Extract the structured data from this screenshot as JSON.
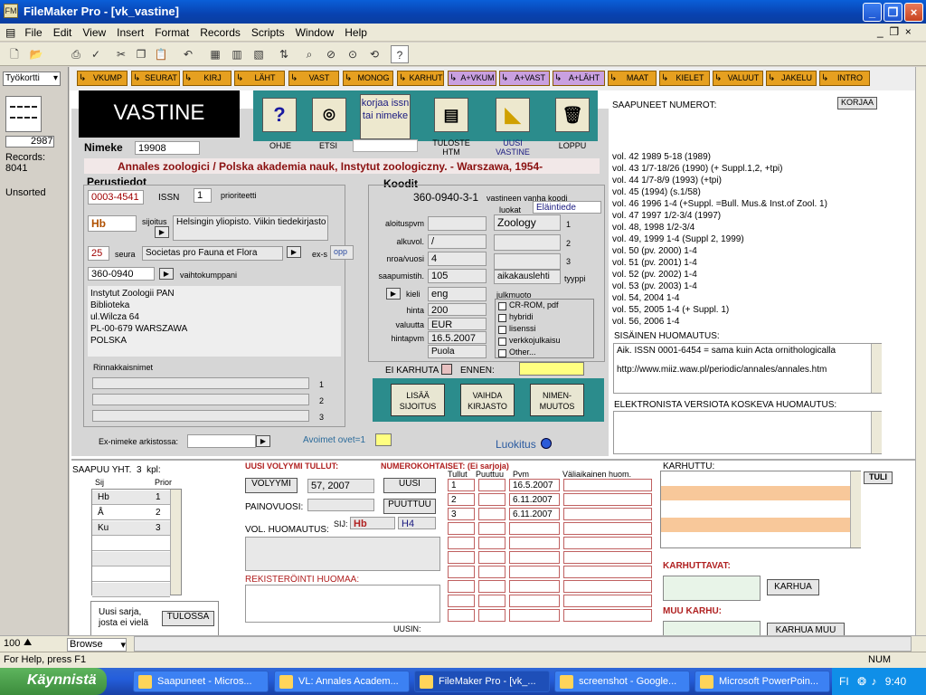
{
  "window": {
    "title": "FileMaker Pro - [vk_vastine]",
    "minimize": "_",
    "restore": "❐",
    "close": "×"
  },
  "menu": [
    "File",
    "Edit",
    "View",
    "Insert",
    "Format",
    "Records",
    "Scripts",
    "Window",
    "Help"
  ],
  "left": {
    "layout_select": "Työkortti",
    "record_number": "2987",
    "records_label": "Records:",
    "records_count": "8041",
    "sort_status": "Unsorted",
    "zoom": "100",
    "mode": "Browse"
  },
  "nav": [
    "VKUMP",
    "SEURAT",
    "KIRJ",
    "LÄHT",
    "VAST",
    "MONOG",
    "KARHUT",
    "A+VKUM",
    "A+VAST",
    "A+LÄHT",
    "MAAT",
    "KIELET",
    "VALUUT",
    "JAKELU",
    "INTRO"
  ],
  "header": {
    "title": "VASTINE",
    "fix_issn": "korjaa issn tai nimeke"
  },
  "buttons": {
    "help": "OHJE",
    "search": "ETSI",
    "print": "TULOSTE HTM",
    "new": "UUSI VASTINE",
    "end": "LOPPU",
    "new_icon": "◣"
  },
  "record": {
    "nimeke_label": "Nimeke",
    "nimeke": "19908",
    "publication": "Annales zoologici / Polska akademia nauk, Instytut zoologiczny. - Warszawa, 1954-"
  },
  "perustiedot": {
    "title": "Perustiedot",
    "issn": "0003-4541",
    "issn_label": "ISSN",
    "priority": "1",
    "priority_label": "prioriteetti",
    "sijoitus_code": "Hb",
    "sijoitus_label": "sijoitus",
    "sijoitus_text": "Helsingin yliopisto. Viikin tiedekirjasto",
    "seura_code": "25",
    "seura_label": "seura",
    "seura_text": "Societas pro Fauna et Flora",
    "exs_label": "ex-s",
    "exs_value": "opp",
    "partner_code": "360-0940",
    "partner_label": "vaihtokumppani",
    "address": [
      "Instytut Zoologii PAN",
      "Biblioteka",
      "ul.Wilcza 64",
      "PL-00-679 WARSZAWA",
      "POLSKA"
    ],
    "rinnakkais_label": "Rinnakkaisnimet",
    "rinnakkais_nums": [
      "1",
      "2",
      "3"
    ],
    "exnimeke_label": "Ex-nimeke arkistossa:",
    "avoimet_label": "Avoimet ovet=1",
    "luokitus": "Luokitus"
  },
  "koodit": {
    "title": "Koodit",
    "code": "360-0940-3-1",
    "vanha_label": "vastineen vanha koodi",
    "luokat_label": "luokat",
    "luokat_value": "Eläintiede",
    "labels": [
      "aloituspvm",
      "alkuvol.",
      "nroa/vuosi",
      "saapumistih.",
      "kieli",
      "hinta",
      "valuutta",
      "hintapvm"
    ],
    "values": [
      "",
      "/",
      "4",
      "105",
      "eng",
      "200",
      "EUR",
      "16.5.2007"
    ],
    "puola": "Puola",
    "class_values": [
      "Zoology",
      "",
      ""
    ],
    "class_nums": [
      "1",
      "2",
      "3"
    ],
    "aikakauslehti": "aikakauslehti",
    "tyyppi_label": "tyyppi",
    "julkmuoto_label": "julkmuoto",
    "julkmuoto": [
      "CR-ROM, pdf",
      "hybridi",
      "lisenssi",
      "verkkojulkaisu",
      "Other..."
    ],
    "ei_karhuta": "EI KARHUTA",
    "ennen": "ENNEN:"
  },
  "action_buttons": [
    "LISÄÄ SIJOITUS",
    "VAIHDA KIRJASTO",
    "NIMEN-MUUTOS"
  ],
  "right": {
    "saapuneet_label": "SAAPUNEET NUMEROT:",
    "korjaa": "KORJAA",
    "volumes": [
      "vol. 42 1989 5-18 (1989)",
      "vol. 43 1/7-18/26 (1990)  (+ Suppl.1,2, +tpi)",
      "vol. 44 1/7-8/9 (1993) (+tpi)",
      "vol. 45 (1994) (s.1/58)",
      "vol. 46 1996 1-4 (+Suppl. =Bull. Mus.& Inst.of Zool. 1)",
      "vol. 47 1997 1/2-3/4 (1997)",
      "vol. 48, 1998 1/2-3/4",
      "vol. 49, 1999 1-4 (Suppl 2, 1999)",
      "vol. 50 (pv. 2000) 1-4",
      "vol. 51 (pv. 2001) 1-4",
      "vol. 52 (pv. 2002) 1-4",
      "vol. 53 (pv. 2003) 1-4",
      "vol. 54, 2004 1-4",
      "vol. 55, 2005 1-4 (+ Suppl. 1)",
      "vol. 56, 2006 1-4"
    ],
    "sisainen_label": "SISÄINEN HUOMAUTUS:",
    "sisainen": [
      "Aik. ISSN 0001-6454 = sama kuin Acta ornithologicalla",
      "http://www.miiz.waw.pl/periodic/annales/annales.htm"
    ],
    "elektroninen_label": "ELEKTRONISTA VERSIOTA KOSKEVA HUOMAUTUS:"
  },
  "bottom": {
    "saapuu_label": "SAAPUU YHT.",
    "saapuu_count": "3",
    "kpl": "kpl:",
    "sij_label": "Sij",
    "prior_label": "Prior",
    "sij_rows": [
      {
        "sij": "Hb",
        "prior": "1"
      },
      {
        "sij": "Å",
        "prior": "2"
      },
      {
        "sij": "Ku",
        "prior": "3"
      }
    ],
    "uusi_sarja": "Uusi sarja, josta ei vielä",
    "tulossa": "TULOSSA",
    "uusi_vol_label": "UUSI VOLYYMI TULLUT:",
    "volyymi_btn": "VOLYYMI",
    "volyymi_value": "57, 2007",
    "painovuosi_label": "PAINOVUOSI:",
    "uusi_btn": "UUSI",
    "puuttuu_btn": "PUUTTUU",
    "vol_huom_label": "VOL. HUOMAUTUS:",
    "sij_label2": "SIJ:",
    "sij_val": "Hb",
    "sij_val2": "H4",
    "rekisteri_label": "REKISTERÖINTI HUOMAA:",
    "uusin_label": "UUSIN:",
    "numerokoht_label": "NUMEROKOHTAISET: (Ei sarjoja)",
    "num_headers": [
      "Tullut",
      "Puuttuu",
      "Pvm",
      "Väliaikainen huom."
    ],
    "num_rows": [
      {
        "n": "1",
        "pvm": "16.5.2007"
      },
      {
        "n": "2",
        "pvm": "6.11.2007"
      },
      {
        "n": "3",
        "pvm": "6.11.2007"
      }
    ],
    "karhuttu_label": "KARHUTTU:",
    "tuli": "TULI",
    "karhuttavat_label": "KARHUTTAVAT:",
    "karhua": "KARHUA",
    "muu_karhu_label": "MUU KARHU:",
    "karhua_muu": "KARHUA MUU"
  },
  "status": {
    "help": "For Help, press F1",
    "num": "NUM"
  },
  "taskbar": {
    "start": "Käynnistä",
    "tasks": [
      "Saapuneet - Micros...",
      "VL: Annales Academ...",
      "FileMaker Pro - [vk_...",
      "screenshot - Google...",
      "Microsoft PowerPoin..."
    ],
    "lang": "FI",
    "time": "9:40"
  }
}
